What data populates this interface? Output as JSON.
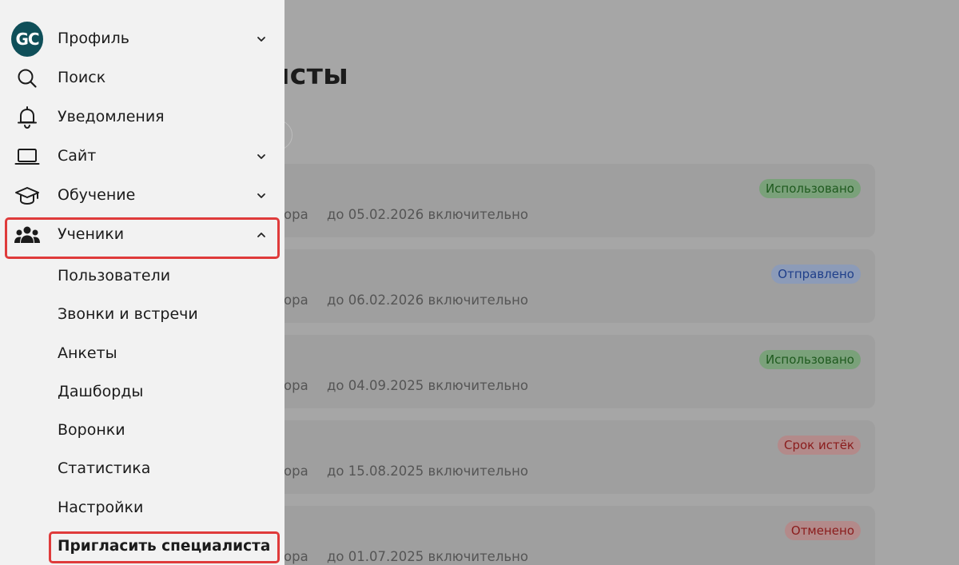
{
  "main": {
    "title_fragment": "ые специалисты",
    "cards": [
      {
        "prefix": "ора",
        "date": "до 05.02.2026 включительно",
        "status": "Использовано",
        "tone": "green"
      },
      {
        "prefix": "ора",
        "date": "до 06.02.2026 включительно",
        "status": "Отправлено",
        "tone": "blue"
      },
      {
        "prefix": "ора",
        "date": "до 04.09.2025 включительно",
        "status": "Использовано",
        "tone": "green"
      },
      {
        "prefix": "ора",
        "date": "до 15.08.2025 включительно",
        "status": "Срок истёк",
        "tone": "red"
      },
      {
        "prefix": "ора",
        "date": "до 01.07.2025 включительно",
        "status": "Отменено",
        "tone": "red"
      }
    ]
  },
  "sidebar": {
    "avatar_text": "GC",
    "items": [
      {
        "label": "Профиль",
        "icon": "avatar",
        "chevron": "down"
      },
      {
        "label": "Поиск",
        "icon": "search-icon"
      },
      {
        "label": "Уведомления",
        "icon": "bell-icon"
      },
      {
        "label": "Сайт",
        "icon": "laptop-icon",
        "chevron": "down"
      },
      {
        "label": "Обучение",
        "icon": "graduation-cap-icon",
        "chevron": "down"
      },
      {
        "label": "Ученики",
        "icon": "users-icon",
        "chevron": "up"
      }
    ],
    "subitems": [
      {
        "label": "Пользователи"
      },
      {
        "label": "Звонки и встречи"
      },
      {
        "label": "Анкеты"
      },
      {
        "label": "Дашборды"
      },
      {
        "label": "Воронки"
      },
      {
        "label": "Статистика"
      },
      {
        "label": "Настройки"
      },
      {
        "label": "Пригласить специалиста"
      }
    ]
  },
  "colors": {
    "highlight": "#df3b3b",
    "avatar_bg": "#0f4f59",
    "sidebar_bg": "#f2f2f2",
    "overlay_bg": "#a6a6a6"
  }
}
